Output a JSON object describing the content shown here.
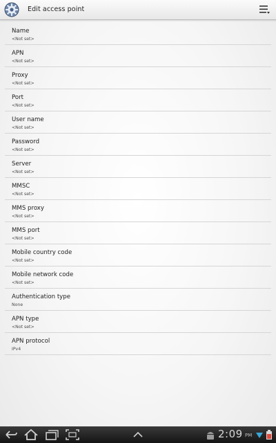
{
  "header": {
    "title": "Edit access point",
    "app_icon": "settings-gear-icon",
    "menu_icon": "overflow-menu-icon"
  },
  "settings": [
    {
      "label": "Name",
      "value": "<Not set>"
    },
    {
      "label": "APN",
      "value": "<Not set>"
    },
    {
      "label": "Proxy",
      "value": "<Not set>"
    },
    {
      "label": "Port",
      "value": "<Not set>"
    },
    {
      "label": "User name",
      "value": "<Not set>"
    },
    {
      "label": "Password",
      "value": "<Not set>"
    },
    {
      "label": "Server",
      "value": "<Not set>"
    },
    {
      "label": "MMSC",
      "value": "<Not set>"
    },
    {
      "label": "MMS proxy",
      "value": "<Not set>"
    },
    {
      "label": "MMS port",
      "value": "<Not set>"
    },
    {
      "label": "Mobile country code",
      "value": "<Not set>"
    },
    {
      "label": "Mobile network code",
      "value": "<Not set>"
    },
    {
      "label": "Authentication type",
      "value": "None"
    },
    {
      "label": "APN type",
      "value": "<Not set>"
    },
    {
      "label": "APN protocol",
      "value": "IPv4"
    }
  ],
  "navbar": {
    "time": "2:09",
    "ampm": "PM",
    "buttons": [
      "back-icon",
      "home-icon",
      "recent-apps-icon",
      "screenshot-icon",
      "chevron-up-icon"
    ],
    "status_icons": [
      "android-icon",
      "wifi-icon",
      "battery-icon"
    ]
  }
}
